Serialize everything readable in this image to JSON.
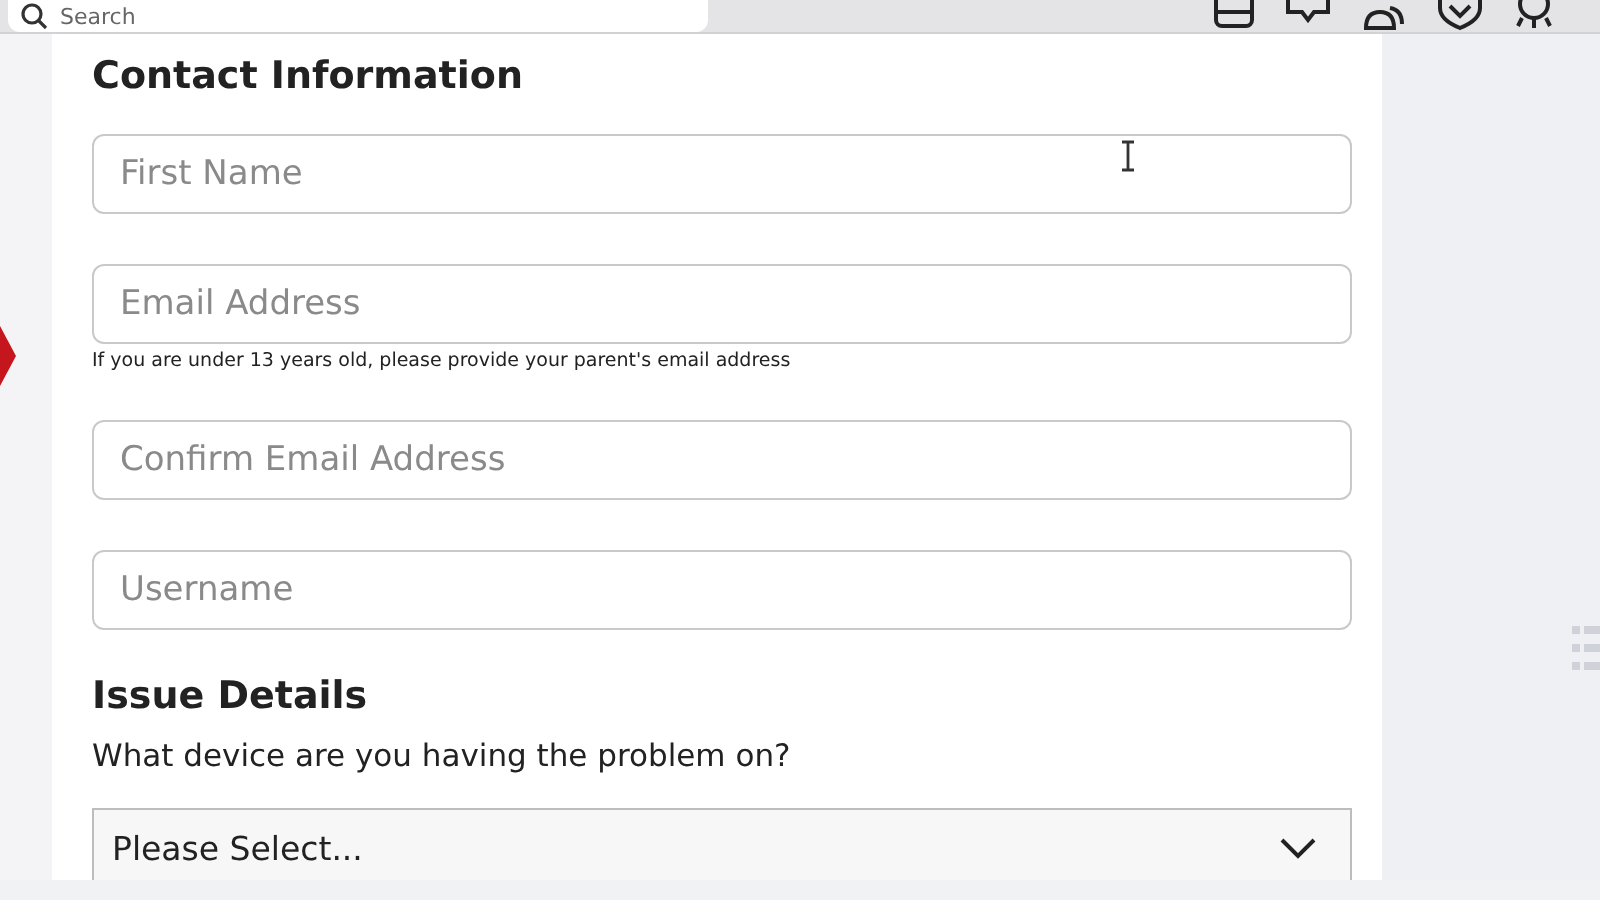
{
  "top_bar": {
    "search": {
      "placeholder": "Search"
    }
  },
  "contact": {
    "title": "Contact Information",
    "fields": [
      {
        "placeholder": "First Name"
      },
      {
        "placeholder": "Email Address",
        "hint": "If you are under 13 years old, please provide your parent's email address"
      },
      {
        "placeholder": "Confirm Email Address"
      },
      {
        "placeholder": "Username"
      }
    ]
  },
  "issue": {
    "title": "Issue Details",
    "question": "What device are you having the problem on?",
    "select": {
      "value": "Please Select..."
    }
  }
}
